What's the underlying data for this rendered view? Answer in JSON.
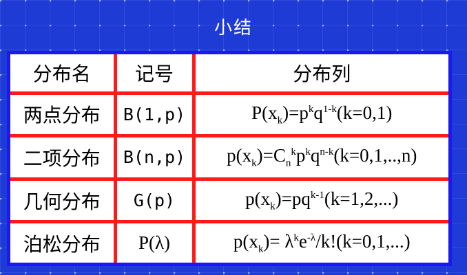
{
  "title": "小结",
  "header": {
    "name": "分布名",
    "symbol": "记号",
    "distribution": "分布列"
  },
  "rows": [
    {
      "name": "两点分布",
      "symbol": "B(1,p)",
      "formula": {
        "a": "P(x",
        "b": "k",
        "c": ")=p",
        "d": "k",
        "e": "q",
        "f": "1-k",
        "g": "(k=0,1)"
      }
    },
    {
      "name": "二项分布",
      "symbol": "B(n,p)",
      "formula": {
        "a": "p(x",
        "b": "k",
        "c": ")=C",
        "d": "n",
        "e": "k",
        "f": "p",
        "g": "k",
        "h": "q",
        "i": "n-k",
        "j": "(k=0,1,..,n)"
      }
    },
    {
      "name": "几何分布",
      "symbol": "G(p)",
      "formula": {
        "a": "p(x",
        "b": "k",
        "c": ")=pq",
        "d": "k-1",
        "e": "(k=1,2,...)"
      }
    },
    {
      "name": "泊松分布",
      "symbol": "P(λ)",
      "formula": {
        "a": "p(x",
        "b": "k",
        "c": ")= λ",
        "d": "k",
        "e": "e",
        "f": "-λ",
        "g": "/k!(k=0,1,...)"
      }
    }
  ]
}
